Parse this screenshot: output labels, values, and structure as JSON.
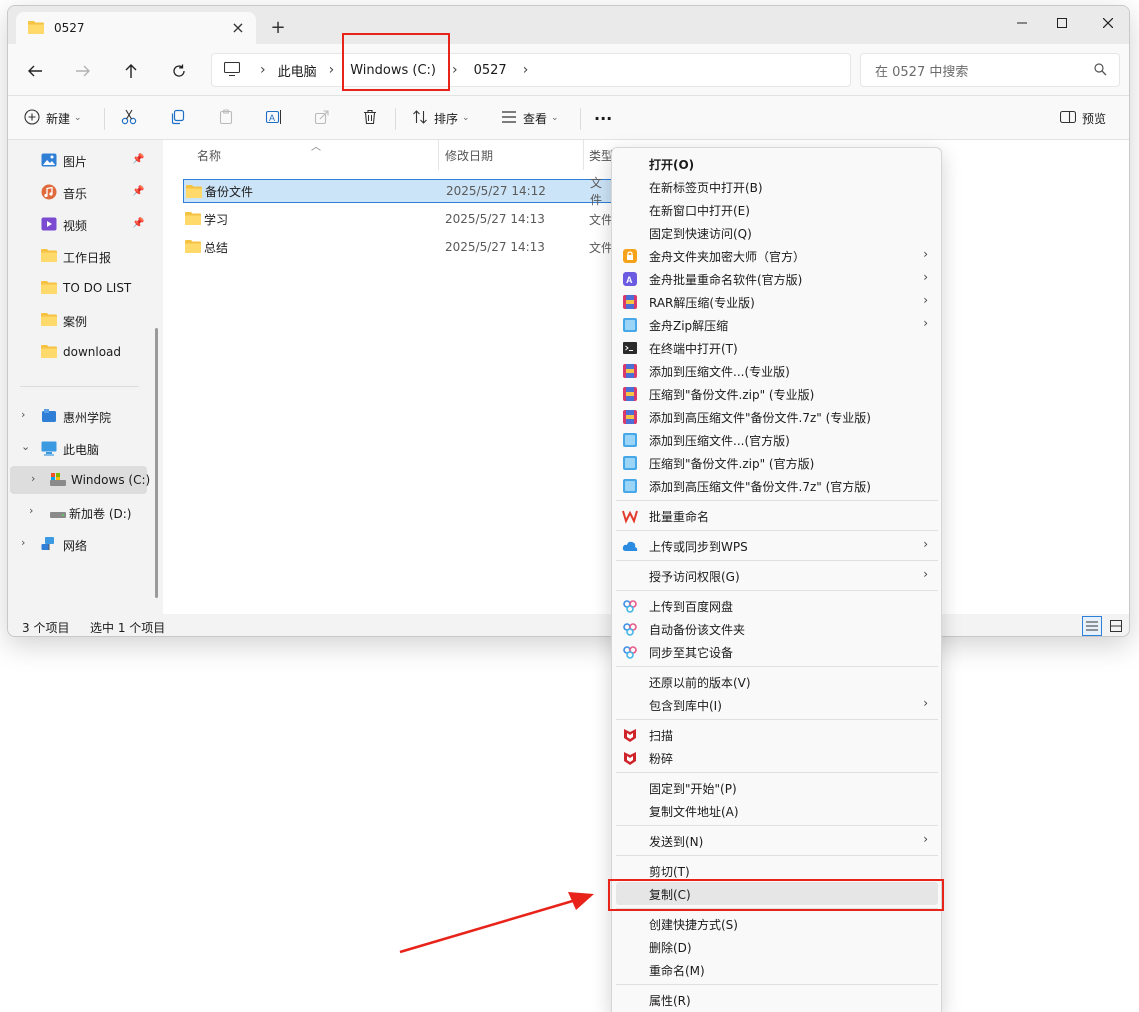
{
  "window": {
    "tab_title": "0527",
    "tab_close": "×",
    "new_tab": "+"
  },
  "nav": {
    "breadcrumb": [
      "此电脑",
      "Windows (C:)",
      "0527"
    ],
    "search_placeholder": "在 0527 中搜索"
  },
  "commandbar": {
    "new_label": "新建",
    "sort_label": "排序",
    "view_label": "查看",
    "more_label": "···",
    "preview_label": "预览"
  },
  "sidebar": {
    "quick_items": [
      {
        "label": "图片",
        "icon": "pictures-icon"
      },
      {
        "label": "音乐",
        "icon": "music-icon"
      },
      {
        "label": "视频",
        "icon": "video-icon"
      },
      {
        "label": "工作日报",
        "icon": "folder-icon"
      },
      {
        "label": "TO DO LIST",
        "icon": "folder-icon"
      },
      {
        "label": "案例",
        "icon": "folder-icon"
      },
      {
        "label": "download",
        "icon": "folder-icon"
      }
    ],
    "tree_items": [
      {
        "label": "惠州学院",
        "icon": "cloud-folder-icon"
      },
      {
        "label": "此电脑",
        "icon": "this-pc-icon"
      },
      {
        "label": "Windows (C:)",
        "icon": "drive-c-icon"
      },
      {
        "label": "新加卷 (D:)",
        "icon": "drive-d-icon"
      },
      {
        "label": "网络",
        "icon": "network-icon"
      }
    ]
  },
  "content": {
    "columns": [
      "名称",
      "修改日期",
      "类型"
    ],
    "rows": [
      {
        "name": "备份文件",
        "date": "2025/5/27 14:12",
        "type": "文件"
      },
      {
        "name": "学习",
        "date": "2025/5/27 14:13",
        "type": "文件"
      },
      {
        "name": "总结",
        "date": "2025/5/27 14:13",
        "type": "文件"
      }
    ]
  },
  "status": {
    "count": "3 个项目",
    "selected": "选中 1 个项目"
  },
  "context_menu": {
    "items": [
      {
        "label": "打开(O)",
        "bold": true
      },
      {
        "label": "在新标签页中打开(B)"
      },
      {
        "label": "在新窗口中打开(E)"
      },
      {
        "label": "固定到快速访问(Q)"
      },
      {
        "label": "金舟文件夹加密大师（官方）",
        "icon": "lock-app-icon",
        "sub": true
      },
      {
        "label": "金舟批量重命名软件(官方版)",
        "icon": "rename-app-icon",
        "sub": true
      },
      {
        "label": "RAR解压缩(专业版)",
        "icon": "rar-icon",
        "sub": true
      },
      {
        "label": "金舟Zip解压缩",
        "icon": "zip-icon",
        "sub": true
      },
      {
        "label": "在终端中打开(T)",
        "icon": "terminal-icon"
      },
      {
        "label": "添加到压缩文件...(专业版)",
        "icon": "rar-icon"
      },
      {
        "label": "压缩到\"备份文件.zip\" (专业版)",
        "icon": "rar-icon"
      },
      {
        "label": "添加到高压缩文件\"备份文件.7z\" (专业版)",
        "icon": "rar-icon"
      },
      {
        "label": "添加到压缩文件...(官方版)",
        "icon": "zip-icon"
      },
      {
        "label": "压缩到\"备份文件.zip\" (官方版)",
        "icon": "zip-icon"
      },
      {
        "label": "添加到高压缩文件\"备份文件.7z\" (官方版)",
        "icon": "zip-icon"
      },
      {
        "label": "批量重命名",
        "icon": "wps-icon"
      },
      {
        "label": "上传或同步到WPS",
        "icon": "wps-cloud-icon",
        "sub": true
      },
      {
        "label": "授予访问权限(G)",
        "sub": true
      },
      {
        "label": "上传到百度网盘",
        "icon": "baidu-icon"
      },
      {
        "label": "自动备份该文件夹",
        "icon": "baidu-icon"
      },
      {
        "label": "同步至其它设备",
        "icon": "baidu-icon"
      },
      {
        "label": "还原以前的版本(V)"
      },
      {
        "label": "包含到库中(I)",
        "sub": true
      },
      {
        "label": "扫描",
        "icon": "mcafee-icon"
      },
      {
        "label": "粉碎",
        "icon": "mcafee-icon"
      },
      {
        "label": "固定到\"开始\"(P)"
      },
      {
        "label": "复制文件地址(A)"
      },
      {
        "label": "发送到(N)",
        "sub": true
      },
      {
        "label": "剪切(T)"
      },
      {
        "label": "复制(C)",
        "highlight": true
      },
      {
        "label": "创建快捷方式(S)"
      },
      {
        "label": "删除(D)"
      },
      {
        "label": "重命名(M)"
      },
      {
        "label": "属性(R)"
      }
    ]
  },
  "colors": {
    "accent": "#2d7fd8",
    "annotation_red": "#e8231a",
    "folder_yellow": "#f4c343"
  }
}
